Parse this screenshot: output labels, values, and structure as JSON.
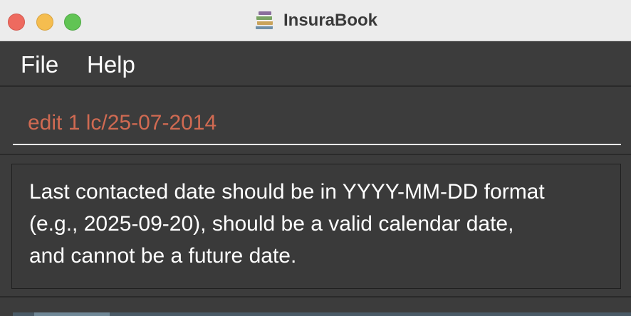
{
  "window": {
    "title": "InsuraBook",
    "app_icon": "books-icon"
  },
  "menu": {
    "items": [
      {
        "label": "File"
      },
      {
        "label": "Help"
      }
    ]
  },
  "command": {
    "value": "edit 1 lc/25-07-2014",
    "text_color": "#d06a52"
  },
  "result": {
    "lines": [
      "Last contacted date should be in YYYY-MM-DD format",
      "(e.g., 2025-09-20), should be a valid calendar date,",
      "and cannot be a future date."
    ]
  },
  "colors": {
    "background": "#3c3c3c",
    "titlebar": "#ececec",
    "close": "#ee6a5f",
    "minimize": "#f5bd4f",
    "maximize": "#61c454"
  }
}
